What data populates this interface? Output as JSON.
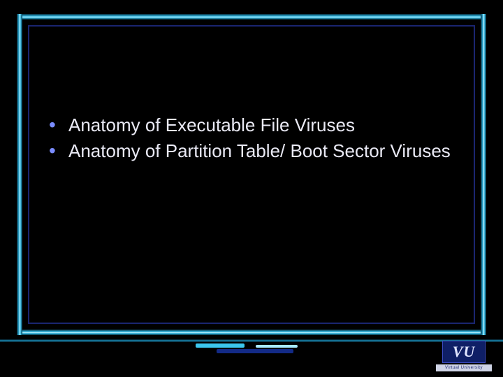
{
  "bullets": [
    "Anatomy of Executable File Viruses",
    "Anatomy of Partition Table/ Boot Sector Viruses"
  ],
  "logo": {
    "text": "VU",
    "caption": "Virtual University"
  }
}
